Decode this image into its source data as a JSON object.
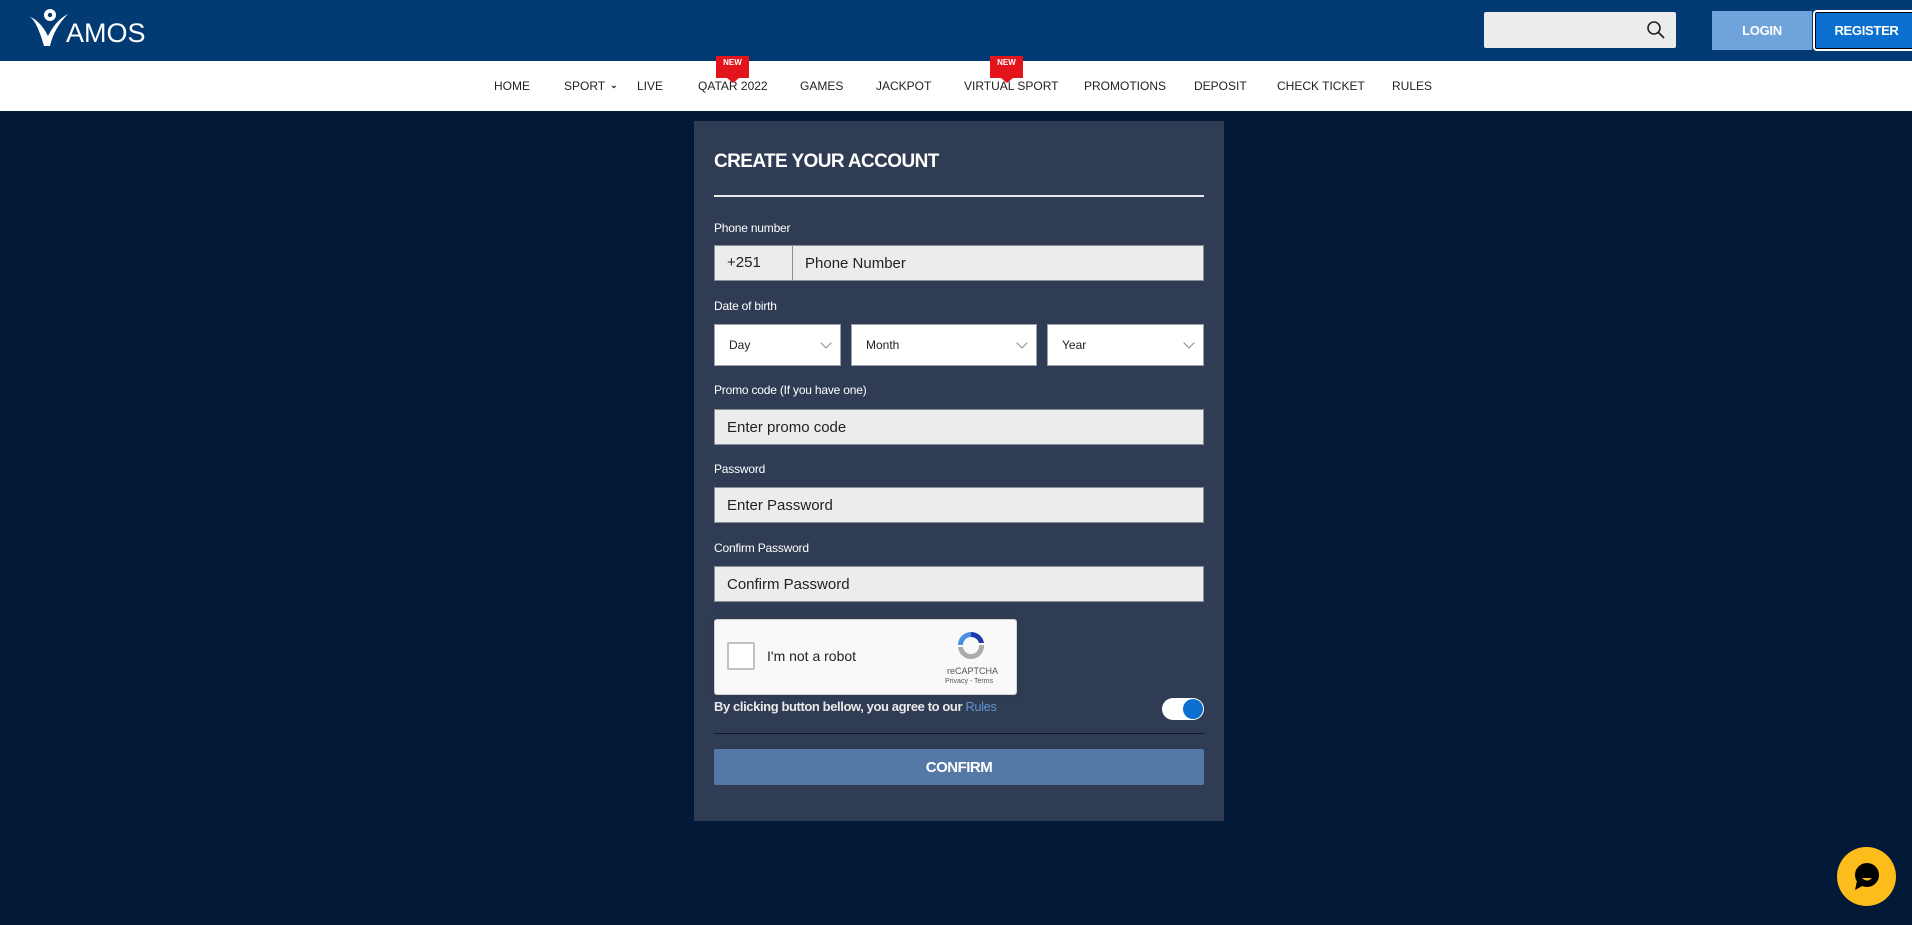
{
  "header": {
    "logo_text": "AMOS",
    "logo_alt": "Vamos",
    "search": {
      "placeholder": "",
      "value": ""
    },
    "login_label": "LOGIN",
    "register_label": "REGISTER"
  },
  "nav": {
    "items": [
      {
        "label": "HOME"
      },
      {
        "label": "SPORT",
        "has_dropdown": true
      },
      {
        "label": "LIVE"
      },
      {
        "label": "QATAR 2022",
        "badge": "NEW"
      },
      {
        "label": "GAMES"
      },
      {
        "label": "JACKPOT"
      },
      {
        "label": "VIRTUAL SPORT",
        "badge": "NEW"
      },
      {
        "label": "PROMOTIONS"
      },
      {
        "label": "DEPOSIT"
      },
      {
        "label": "CHECK TICKET"
      },
      {
        "label": "RULES"
      }
    ]
  },
  "form": {
    "title": "CREATE YOUR ACCOUNT",
    "phone": {
      "label": "Phone number",
      "prefix": "+251",
      "placeholder": "Phone Number",
      "value": ""
    },
    "dob": {
      "label": "Date of birth",
      "day": "Day",
      "month": "Month",
      "year": "Year"
    },
    "promo": {
      "label": "Promo code (If you have one)",
      "placeholder": "Enter promo code",
      "value": ""
    },
    "password": {
      "label": "Password",
      "placeholder": "Enter Password",
      "value": ""
    },
    "confirm_password": {
      "label": "Confirm Password",
      "placeholder": "Confirm Password",
      "value": ""
    },
    "captcha": {
      "text": "I'm not a robot",
      "brand": "reCAPTCHA",
      "links": "Privacy - Terms",
      "checked": false
    },
    "agree": {
      "text": "By clicking button bellow, you agree to our ",
      "link": "Rules",
      "toggle_on": true
    },
    "confirm_label": "CONFIRM"
  },
  "colors": {
    "header_bg": "#023a74",
    "page_bg": "#021a37",
    "panel_bg": "#2f3c53",
    "accent": "#0a6fcf",
    "login_bg": "#6ea3dc",
    "confirm_bg": "#5579a6",
    "badge": "#e3141b",
    "chat": "#fcbc1b"
  }
}
